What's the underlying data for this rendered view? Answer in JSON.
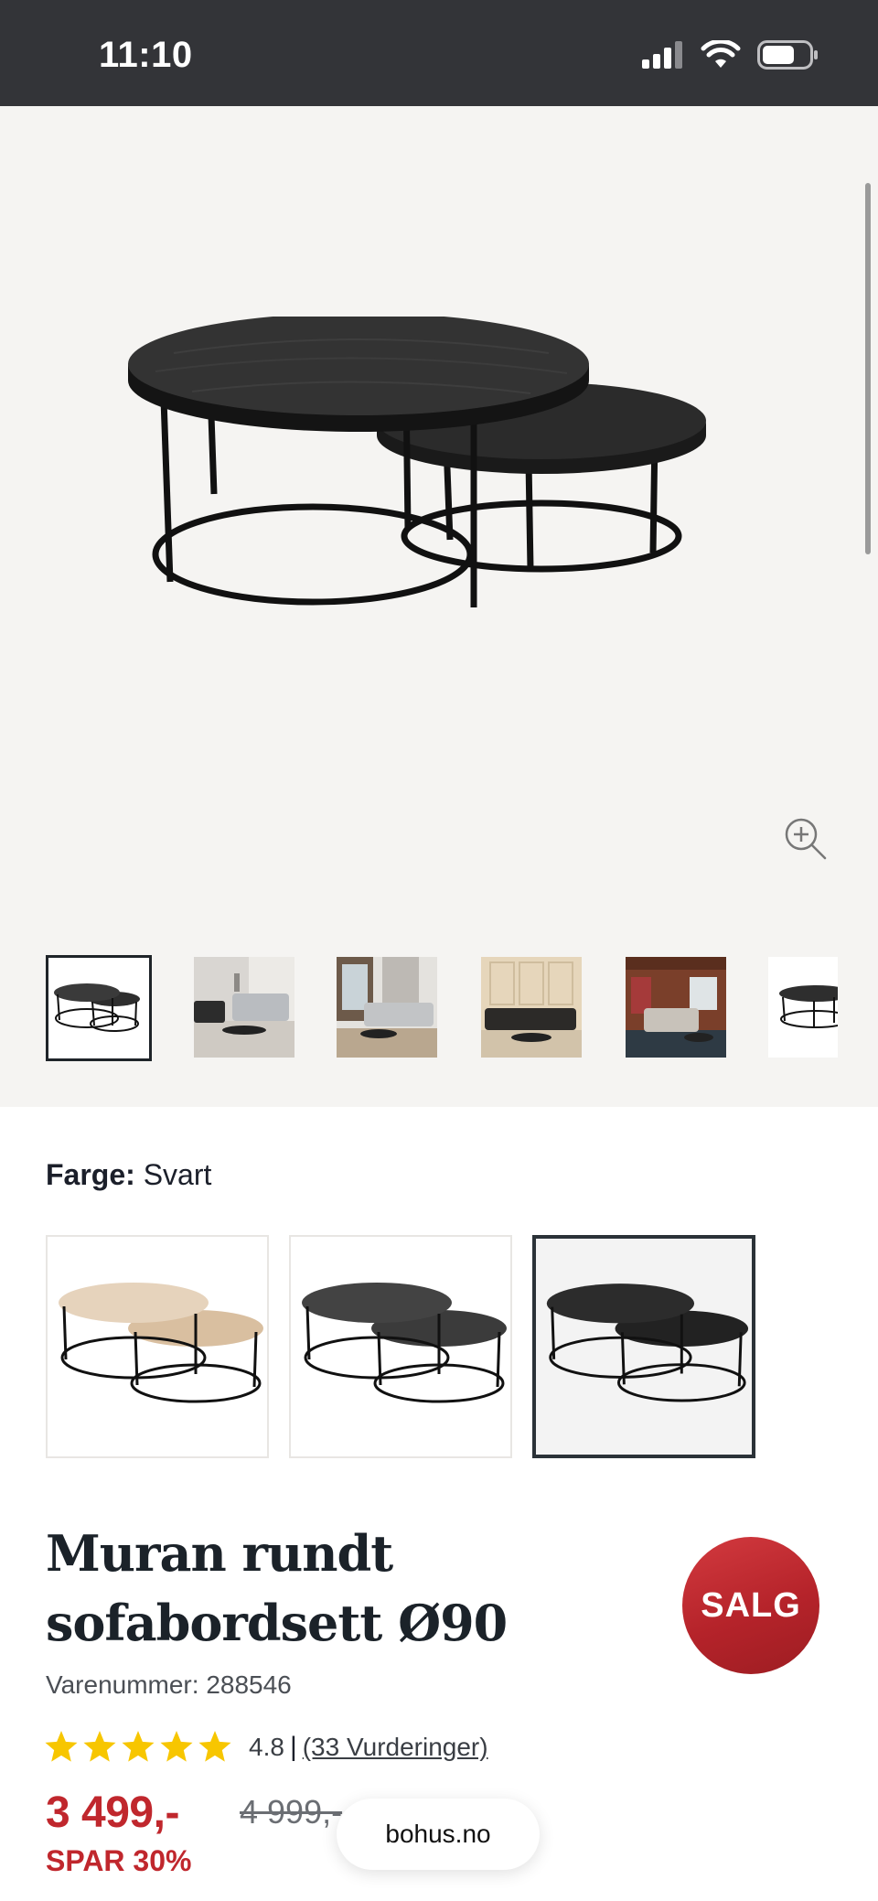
{
  "status_bar": {
    "time": "11:10",
    "icons": [
      "signal-icon",
      "wifi-icon",
      "battery-icon"
    ]
  },
  "gallery": {
    "thumbnails": [
      "product-cutout",
      "living-room-gray-sofa",
      "living-room-window",
      "living-room-beige-wall",
      "living-room-wood-cabin",
      "product-cutout-partial"
    ],
    "active_thumbnail": 0,
    "zoom_icon": "zoom-in-icon"
  },
  "color": {
    "label": "Farge:",
    "value": "Svart",
    "options": [
      "oak",
      "dark",
      "black"
    ],
    "selected_index": 2
  },
  "product": {
    "title_line1": "Muran rundt",
    "title_line2": "sofabordsett Ø90",
    "sku": "Varenummer: 288546",
    "sale_badge": "SALG",
    "rating_value": "4.8",
    "rating_stars": 5,
    "rating_separator": "|",
    "reviews_link": "(33 Vurderinger)",
    "price": "3 499,-",
    "old_price": "4 999,-",
    "save_text": "SPAR 30%"
  },
  "browser": {
    "domain": "bohus.no"
  },
  "colors": {
    "status_bar": "#333438",
    "gallery_bg": "#f5f4f2",
    "sale_red": "#c0272d",
    "star_yellow": "#f7c600"
  }
}
